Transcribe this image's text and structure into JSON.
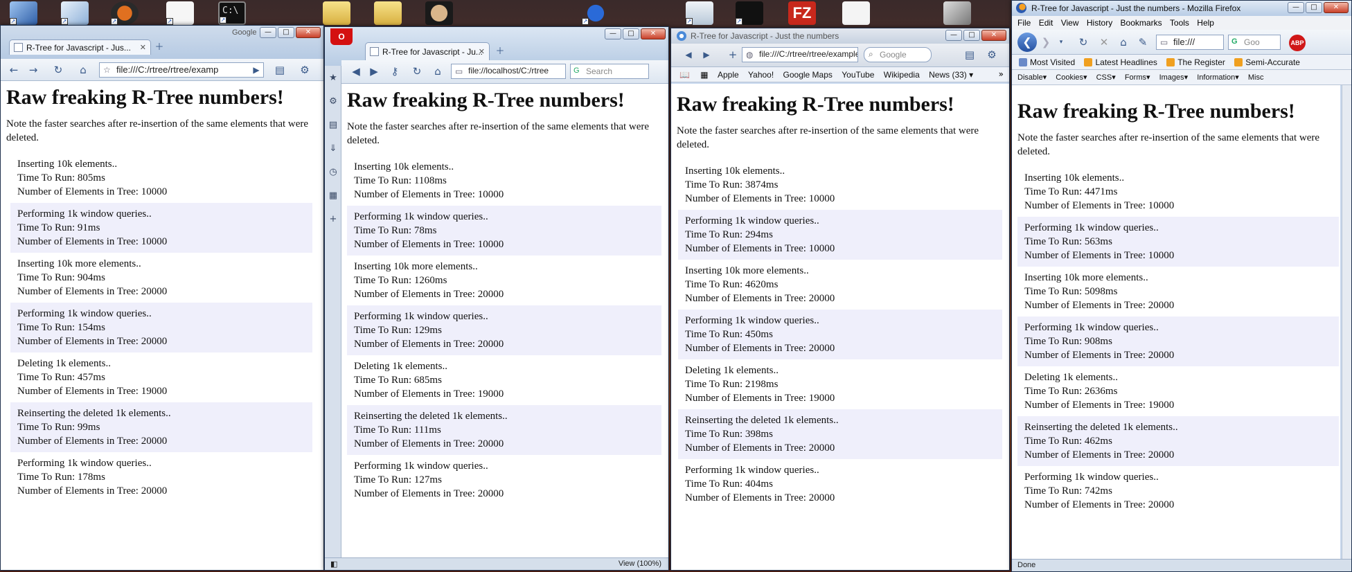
{
  "desktop_icons": [
    "computer-icon",
    "recycle-icon",
    "tf2-icon",
    "document-icon",
    "cmd-icon",
    "folder-icon",
    "folder-icon",
    "jupiter-icon",
    "bomb-icon",
    "recycle-bin-icon",
    "steam-icon",
    "filezilla-icon",
    "document-icon",
    "picture-icon"
  ],
  "colors": {
    "row_alt": "#efeffb",
    "title_gradient_top": "#dfe9f5",
    "desktop": "#7a3a2a"
  },
  "page": {
    "heading": "Raw freaking R-Tree numbers!",
    "note": "Note the faster searches after re-insertion of the same elements that were deleted.",
    "time_label": "Time To Run: ",
    "count_label": "Number of Elements in Tree: "
  },
  "chrome": {
    "tab_title": "R-Tree for Javascript - Jus...",
    "google_label": "Google",
    "url": "file:///C:/rtree/rtree/examp",
    "results": [
      {
        "op": "Inserting 10k elements..",
        "time": "805ms",
        "count": "10000"
      },
      {
        "op": "Performing 1k window queries..",
        "time": "91ms",
        "count": "10000"
      },
      {
        "op": "Inserting 10k more elements..",
        "time": "904ms",
        "count": "20000"
      },
      {
        "op": "Performing 1k window queries..",
        "time": "154ms",
        "count": "20000"
      },
      {
        "op": "Deleting 1k elements..",
        "time": "457ms",
        "count": "19000"
      },
      {
        "op": "Reinserting the deleted 1k elements..",
        "time": "99ms",
        "count": "20000"
      },
      {
        "op": "Performing 1k window queries..",
        "time": "178ms",
        "count": "20000"
      }
    ]
  },
  "opera": {
    "tab_title": "R-Tree for Javascript - Ju...",
    "url": "file://localhost/C:/rtree",
    "search_placeholder": "Search",
    "zoom": "View (100%)",
    "results": [
      {
        "op": "Inserting 10k elements..",
        "time": "1108ms",
        "count": "10000"
      },
      {
        "op": "Performing 1k window queries..",
        "time": "78ms",
        "count": "10000"
      },
      {
        "op": "Inserting 10k more elements..",
        "time": "1260ms",
        "count": "20000"
      },
      {
        "op": "Performing 1k window queries..",
        "time": "129ms",
        "count": "20000"
      },
      {
        "op": "Deleting 1k elements..",
        "time": "685ms",
        "count": "19000"
      },
      {
        "op": "Reinserting the deleted 1k elements..",
        "time": "111ms",
        "count": "20000"
      },
      {
        "op": "Performing 1k window queries..",
        "time": "127ms",
        "count": "20000"
      }
    ]
  },
  "safari": {
    "title": "R-Tree for Javascript - Just the numbers",
    "url": "file:///C:/rtree/rtree/example",
    "search_placeholder": "Google",
    "bookmarks": [
      "Apple",
      "Yahoo!",
      "Google Maps",
      "YouTube",
      "Wikipedia",
      "News (33) ▾"
    ],
    "results": [
      {
        "op": "Inserting 10k elements..",
        "time": "3874ms",
        "count": "10000"
      },
      {
        "op": "Performing 1k window queries..",
        "time": "294ms",
        "count": "10000"
      },
      {
        "op": "Inserting 10k more elements..",
        "time": "4620ms",
        "count": "20000"
      },
      {
        "op": "Performing 1k window queries..",
        "time": "450ms",
        "count": "20000"
      },
      {
        "op": "Deleting 1k elements..",
        "time": "2198ms",
        "count": "19000"
      },
      {
        "op": "Reinserting the deleted 1k elements..",
        "time": "398ms",
        "count": "20000"
      },
      {
        "op": "Performing 1k window queries..",
        "time": "404ms",
        "count": "20000"
      }
    ]
  },
  "firefox": {
    "title": "R-Tree for Javascript - Just the numbers - Mozilla Firefox",
    "menu": [
      "File",
      "Edit",
      "View",
      "History",
      "Bookmarks",
      "Tools",
      "Help"
    ],
    "url": "file:///",
    "search_placeholder": "Goo",
    "bookmarks": [
      "Most Visited",
      "Latest Headlines",
      "The Register",
      "Semi-Accurate"
    ],
    "devtools": [
      "Disable▾",
      "Cookies▾",
      "CSS▾",
      "Forms▾",
      "Images▾",
      "Information▾",
      "Misc"
    ],
    "status": "Done",
    "results": [
      {
        "op": "Inserting 10k elements..",
        "time": "4471ms",
        "count": "10000"
      },
      {
        "op": "Performing 1k window queries..",
        "time": "563ms",
        "count": "10000"
      },
      {
        "op": "Inserting 10k more elements..",
        "time": "5098ms",
        "count": "20000"
      },
      {
        "op": "Performing 1k window queries..",
        "time": "908ms",
        "count": "20000"
      },
      {
        "op": "Deleting 1k elements..",
        "time": "2636ms",
        "count": "19000"
      },
      {
        "op": "Reinserting the deleted 1k elements..",
        "time": "462ms",
        "count": "20000"
      },
      {
        "op": "Performing 1k window queries..",
        "time": "742ms",
        "count": "20000"
      }
    ]
  }
}
